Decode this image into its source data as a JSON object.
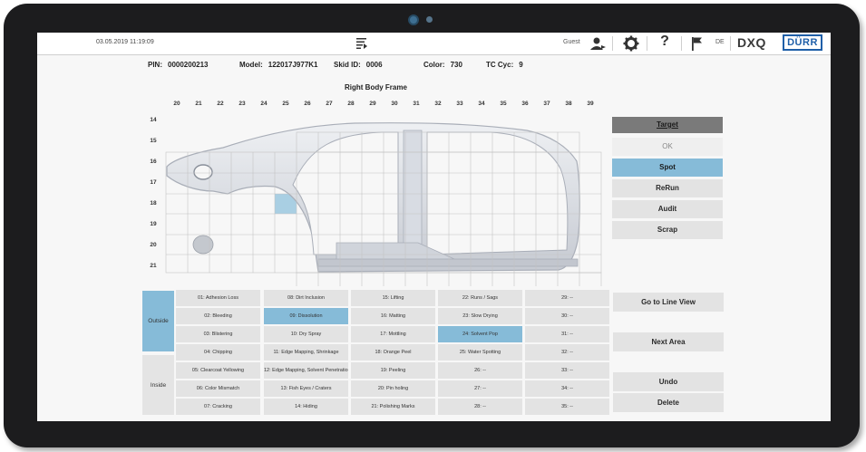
{
  "header": {
    "datetime": "03.05.2019 11:19:09",
    "user": "Guest",
    "language": "DE",
    "product": "DXQ",
    "brand": "DÜRR",
    "icons": [
      "menu-list-icon",
      "user-role-icon",
      "gear-icon",
      "help-icon",
      "flag-icon"
    ]
  },
  "info": {
    "pin_label": "PIN:",
    "pin": "0000200213",
    "model_label": "Model:",
    "model": "122017J977K1",
    "skid_label": "Skid ID:",
    "skid": "0006",
    "color_label": "Color:",
    "color": "730",
    "tc_label": "TC Cyc:",
    "tc": "9"
  },
  "frame": {
    "title": "Right Body Frame",
    "columns": [
      "20",
      "21",
      "22",
      "23",
      "24",
      "25",
      "26",
      "27",
      "28",
      "29",
      "30",
      "31",
      "32",
      "33",
      "34",
      "35",
      "36",
      "37",
      "38",
      "39"
    ],
    "rows": [
      "14",
      "15",
      "16",
      "17",
      "18",
      "19",
      "20",
      "21"
    ]
  },
  "right_panel": {
    "header": "Target",
    "buttons": [
      {
        "label": "OK",
        "state": "disabled"
      },
      {
        "label": "Spot",
        "state": "selected"
      },
      {
        "label": "ReRun",
        "state": "normal"
      },
      {
        "label": "Audit",
        "state": "normal"
      },
      {
        "label": "Scrap",
        "state": "normal"
      }
    ]
  },
  "tabs": [
    {
      "label": "Outside",
      "active": true
    },
    {
      "label": "Inside",
      "active": false
    }
  ],
  "defects": [
    [
      "01: Adhesion Loss",
      "02: Bleeding",
      "03: Blistering",
      "04: Chipping",
      "05: Clearcoat Yellowing",
      "06: Color Mismatch",
      "07: Cracking"
    ],
    [
      "08: Dirt Inclusion",
      "09: Dissolution",
      "10: Dry Spray",
      "11: Edge Mapping, Shrinkage",
      "12: Edge Mapping, Solvent Penetration",
      "13: Fish Eyes / Craters",
      "14: Hiding"
    ],
    [
      "15: Lifting",
      "16: Matting",
      "17: Mottling",
      "18: Orange Peel",
      "19: Peeling",
      "20: Pin holing",
      "21: Polishing Marks"
    ],
    [
      "22: Runs / Sags",
      "23: Slow Drying",
      "24: Solvent Pop",
      "25: Water Spotting",
      "26: --",
      "27: --",
      "28: --"
    ],
    [
      "29: --",
      "30: --",
      "31: --",
      "32: --",
      "33: --",
      "34: --",
      "35: --"
    ]
  ],
  "selected_defects": [
    "09: Dissolution",
    "24: Solvent Pop"
  ],
  "actions": {
    "go_to_line_view": "Go to Line View",
    "next_area": "Next Area",
    "undo": "Undo",
    "delete": "Delete"
  },
  "colors": {
    "accent": "#86bbd8",
    "button": "#e3e3e3",
    "header_button": "#7a7a7a",
    "brand_blue": "#1f5fa8"
  }
}
